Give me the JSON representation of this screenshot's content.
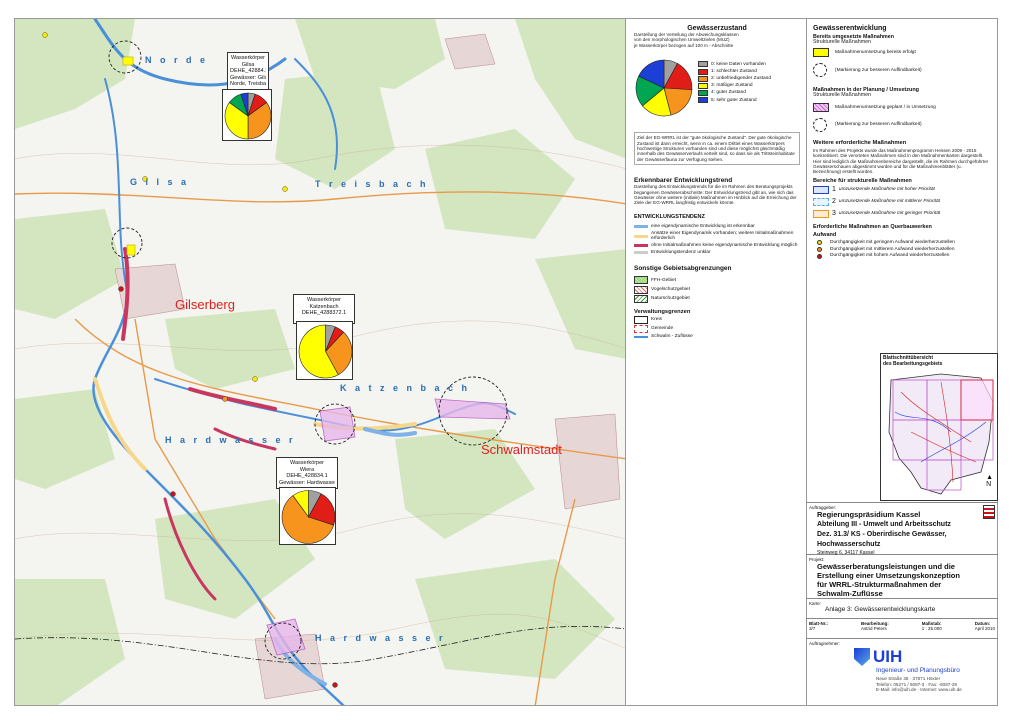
{
  "map": {
    "water_bodies": [
      {
        "label": "N o r d e"
      },
      {
        "label": "G i l s a"
      },
      {
        "label": "T r e i s b a c h"
      },
      {
        "label": "K a t z e n b a c h"
      },
      {
        "label": "H a r d w a s s e r"
      },
      {
        "label": "H a r d w a s s e r"
      }
    ],
    "towns": [
      {
        "label": "Gilserberg"
      },
      {
        "label": "Schwalmstadt"
      }
    ],
    "info_boxes": [
      {
        "lines": [
          "Wasserkörper",
          "Gilsa",
          "DEHE_42884.1",
          "Gewässer: Gilsa,",
          "Norde, Treisbach"
        ],
        "pie": [
          {
            "value": 5,
            "color": "#a0a0a0"
          },
          {
            "value": 10,
            "color": "#e11d17"
          },
          {
            "value": 35,
            "color": "#f7941d"
          },
          {
            "value": 35,
            "color": "#ffff00"
          },
          {
            "value": 10,
            "color": "#00a651"
          },
          {
            "value": 5,
            "color": "#1c3fd6"
          }
        ]
      },
      {
        "lines": [
          "Wasserkörper",
          "Katzenbach",
          "DEHE_4288372.1"
        ],
        "pie": [
          {
            "value": 6,
            "color": "#a0a0a0"
          },
          {
            "value": 6,
            "color": "#e11d17"
          },
          {
            "value": 30,
            "color": "#f7941d"
          },
          {
            "value": 58,
            "color": "#ffff00"
          }
        ]
      },
      {
        "lines": [
          "Wasserkörper",
          "Wiera",
          "DEHE_428834.1",
          "Gewässer: Hardwasser"
        ],
        "pie": [
          {
            "value": 8,
            "color": "#a0a0a0"
          },
          {
            "value": 22,
            "color": "#e11d17"
          },
          {
            "value": 60,
            "color": "#f7941d"
          },
          {
            "value": 10,
            "color": "#ffff00"
          }
        ]
      }
    ]
  },
  "legend": {
    "zustand": {
      "title": "Gewässerzustand",
      "subtitle_lines": [
        "Darstellung der Verteilung der Abweichungsklassen",
        "von den morphologischen Umweltzielen (MUZ)",
        "je Wasserkörper bezogen auf 100 m - Abschnitte"
      ],
      "pie": [
        {
          "value": 8,
          "color": "#a0a0a0"
        },
        {
          "value": 18,
          "color": "#e11d17"
        },
        {
          "value": 20,
          "color": "#f7941d"
        },
        {
          "value": 18,
          "color": "#ffff00"
        },
        {
          "value": 18,
          "color": "#00a651"
        },
        {
          "value": 18,
          "color": "#1c3fd6"
        }
      ],
      "classes": [
        {
          "label": "0: keine Daten vorhanden",
          "color": "#a0a0a0"
        },
        {
          "label": "1: schlechter Zustand",
          "color": "#e11d17"
        },
        {
          "label": "2: unbefriedigender Zustand",
          "color": "#f7941d"
        },
        {
          "label": "3: mäßiger Zustand",
          "color": "#ffff00"
        },
        {
          "label": "4: guter Zustand",
          "color": "#00a651"
        },
        {
          "label": "5: sehr guter Zustand",
          "color": "#1c3fd6"
        }
      ],
      "goal_text": "Ziel der EG-WRRL ist der \"gute ökologische Zustand\". Der gute ökologische Zustand ist dann erreicht, wenn in ca. einem Drittel eines Wasserkörpers hochwertige Strukturen vorhanden sind und diese möglichst gleichmäßig innerhalb des Gewässerverlaufs verteilt sind, so dass sie als Trittsteinhabitate der Gewässerfauna zur Verfügung stehen."
    },
    "trend": {
      "title": "Erkennbarer Entwicklungstrend",
      "text": "Darstellung des Entwicklungstrends für die im Rahmen des Beratungsprojekts begangenen Gewässerabschnitte: Der Entwicklungstrend gibt an, wie sich das Gewässer ohne weitere (initiale) Maßnahmen im Hinblick auf die Erreichung der Ziele der EG-WRRL langfristig entwickeln könnte.",
      "tendency_title": "ENTWICKLUNGSTENDENZ",
      "items": [
        {
          "label": "eine eigendynamische Entwicklung ist erkennbar",
          "color": "#7fb2e6"
        },
        {
          "label": "Ansätze einer Eigendynamik vorhanden; weitere Initialmaßnahmen erforderlich",
          "color": "#f7d78c"
        },
        {
          "label": "ohne Initialmaßnahmen keine eigendynamische Entwicklung möglich",
          "color": "#c7375f"
        },
        {
          "label": "Entwicklungstendenz unklar",
          "color": "#cccccc"
        }
      ]
    },
    "sonstige": {
      "title": "Sonstige Gebietsabgrenzungen",
      "items": [
        {
          "label": "FFH-Gebiet",
          "kind": "ffh"
        },
        {
          "label": "Vogelschutzgebiet",
          "kind": "vogel"
        },
        {
          "label": "Naturschutzgebiet",
          "kind": "nsg"
        }
      ]
    },
    "verwaltung": {
      "title": "Verwaltungsgrenzen",
      "items": [
        {
          "label": "Kreis",
          "kind": "kreis"
        },
        {
          "label": "Gemeinde",
          "kind": "gemeinde"
        },
        {
          "label": "Schwalm - Zuflüsse",
          "kind": "fluss"
        }
      ]
    }
  },
  "right": {
    "entwicklung": {
      "title": "Gewässerentwicklung",
      "bereits_title": "Bereits umgesetzte Maßnahmen",
      "strukturelle_label": "Strukturelle Maßnahmen",
      "bereits_items": [
        {
          "label": "Maßnahmenumsetzung bereits erfolgt",
          "kind": "yellow"
        },
        {
          "label": "(Markierung zur besseren Auffindbarkeit)",
          "kind": "circle"
        }
      ],
      "planung_title": "Maßnahmen in der Planung / Umsetzung",
      "planung_struct": "Strukturelle Maßnahmen",
      "planung_items": [
        {
          "label": "Maßnahmenumsetzung geplant / in Umsetzung",
          "kind": "pink"
        },
        {
          "label": "(Markierung zur besseren Auffindbarkeit)",
          "kind": "circle"
        }
      ],
      "weitere_title": "Weitere erforderliche Maßnahmen",
      "weitere_text": "Im Rahmen des Projekts wurde das Maßnahmenprogramm Hessen 2009 - 2015 konkretisiert. Die verorteten Maßnahmen sind in den Maßnahmenkarten dargestellt. Hier sind lediglich die Maßnahmenbereiche dargestellt, die im Rahmen durchgeführter Gewässerschauen abgestimmt wurden und für die Maßnahmenblätter (u. Bezeichnung) erstellt wurden.",
      "bereiche_title": "Bereiche für strukturelle Maßnahmen",
      "bereiche": [
        {
          "num": "1",
          "label": "umzusetzende Maßnahme mit hoher Priorität",
          "color": "#1c3fd6"
        },
        {
          "num": "2",
          "label": "umzusetzende Maßnahme mit mittlerer Priorität",
          "color": "#5aa9e6"
        },
        {
          "num": "3",
          "label": "umzusetzende Maßnahme mit geringer Priorität",
          "color": "#f7941d"
        }
      ],
      "quer_title": "Erforderliche Maßnahmen an Querbauwerken",
      "aufwand_title": "Aufwand",
      "aufwand": [
        {
          "label": "Durchgängigkeit mit geringem Aufwand wiederherzustellen",
          "color": "#ffe600"
        },
        {
          "label": "Durchgängigkeit mit mittlerem Aufwand wiederherzustellen",
          "color": "#f7941d"
        },
        {
          "label": "Durchgängigkeit mit hohem Aufwand wiederherzustellen",
          "color": "#c4161c"
        }
      ]
    },
    "overview": {
      "title": "Blattschnittübersicht",
      "subtitle": "des Bearbeitungsgebiets"
    },
    "titleblock": {
      "auftraggeber_label": "Auftraggeber:",
      "org_lines": [
        "Regierungspräsidium Kassel",
        "Abteilung III - Umwelt und Arbeitsschutz",
        "Dez. 31.3/ KS - Oberirdische Gewässer,",
        "Hochwasserschutz"
      ],
      "address": "Steinweg 6, 34117 Kassel",
      "projekt_label": "Projekt:",
      "projekt_lines": [
        "Gewässerberatungsleistungen und die",
        "Erstellung einer Umsetzungskonzeption",
        "für WRRL-Strukturmaßnahmen der",
        "Schwalm-Zuflüsse"
      ],
      "karte_label": "Karte:",
      "karte": "Anlage 3: Gewässerentwicklungskarte",
      "blatt_label": "Blatt-Nr.:",
      "blatt": "3/7",
      "bearbeitung_label": "Bearbeitung:",
      "bearbeitung": "Astrid Peters",
      "massstab_label": "Maßstab:",
      "massstab": "1 : 25.000",
      "datum_label": "Datum:",
      "datum": "April 2010",
      "auftragnehmer_label": "Auftragnehmer:",
      "company_logo": "UIH",
      "company_name": "Ingenieur- und Planungsbüro",
      "company_lines": [
        "Neue Straße 36 · 37671 Höxter",
        "Telefon: 05271 / 6087-3 · Fax: -6087-29",
        "E-Mail: info@uih.de · Internet: www.uih.de"
      ]
    }
  }
}
